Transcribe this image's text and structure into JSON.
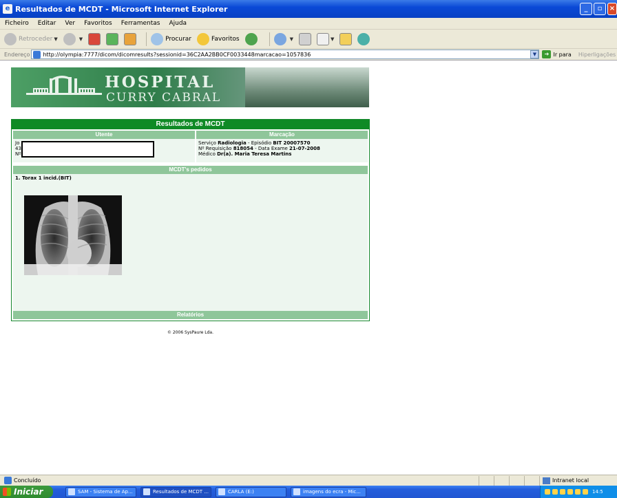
{
  "window": {
    "title": "Resultados de MCDT - Microsoft Internet Explorer"
  },
  "menu": [
    "Ficheiro",
    "Editar",
    "Ver",
    "Favoritos",
    "Ferramentas",
    "Ajuda"
  ],
  "toolbar": {
    "back": "Retroceder",
    "search": "Procurar",
    "favorites": "Favoritos"
  },
  "address": {
    "label": "Endereço",
    "url": "http://olympia:7777/dicom/dicomresults?sessionid=36C2AA2BB0CF0033448marcacao=1057836",
    "go": "Ir para",
    "links": "Hiperligações"
  },
  "banner": {
    "line1": "HOSPITAL",
    "line2": "CURRY CABRAL"
  },
  "results": {
    "title": "Resultados de MCDT",
    "utente": {
      "header": "Utente",
      "line1": "Jo",
      "line2": "43",
      "line3": "Nº"
    },
    "marcacao": {
      "header": "Marcação",
      "servico_label": "Serviço ",
      "servico": "Radiologia",
      "episodio_label": " - Episódio ",
      "episodio": "BIT 20007570",
      "req_label": "Nº Requisição ",
      "requisicao": "818054",
      "data_label": " - Data Exame ",
      "data": "21-07-2008",
      "medico_label": "Médico ",
      "medico": "Dr(a). Maria Teresa Martins"
    },
    "mcdt_header": "MCDT's pedidos",
    "item": "1. Torax 1 incid.(BIT)",
    "relatorios_header": "Relatórios"
  },
  "footer": "© 2006 SysPaure Lda.",
  "status": {
    "text": "Concluído",
    "zone": "Intranet local"
  },
  "taskbar": {
    "start": "Iniciar",
    "tasks": [
      "SAM - Sistema de Ap...",
      "Resultados de MCDT ...",
      "CARLA (E:)",
      "imagens do ecra - Mic..."
    ],
    "clock": "14:5"
  }
}
